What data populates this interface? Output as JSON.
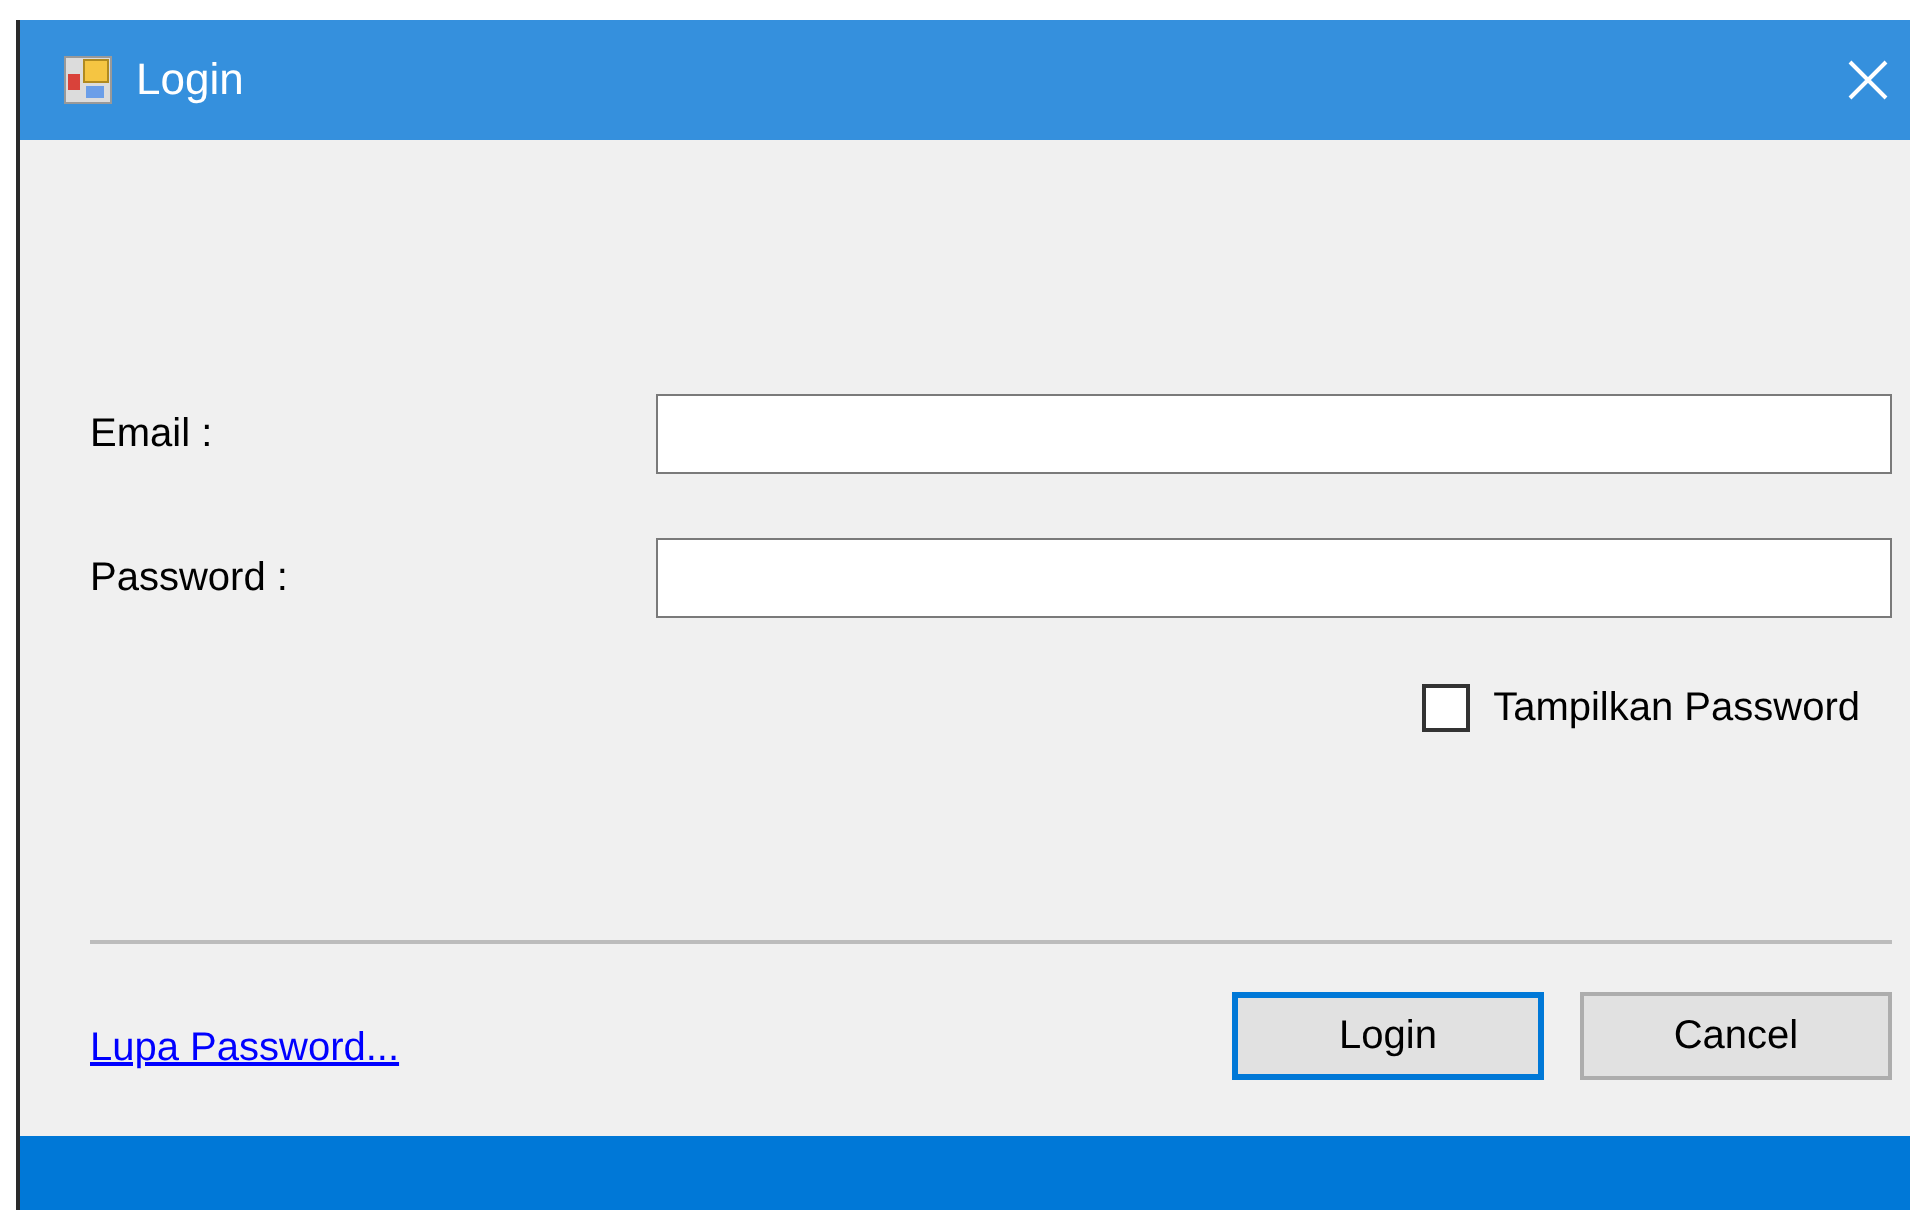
{
  "window": {
    "title": "Login"
  },
  "fields": [
    {
      "label": "Email :"
    },
    {
      "label": "Password :"
    }
  ],
  "show_password": {
    "label": "Tampilkan Password",
    "checked": false
  },
  "forgot_link": "Lupa Password...",
  "buttons": [
    {
      "label": "Login",
      "focused": true
    },
    {
      "label": "Cancel",
      "focused": false
    }
  ]
}
